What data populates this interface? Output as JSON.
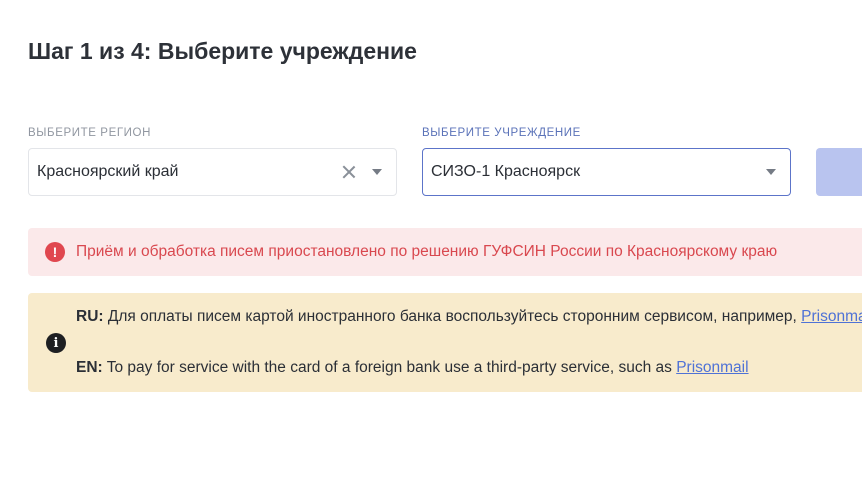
{
  "step": {
    "title": "Шаг 1 из 4: Выберите учреждение"
  },
  "region": {
    "label": "ВЫБЕРИТЕ РЕГИОН",
    "value": "Красноярский край",
    "clear_icon": "close-icon",
    "dropdown_icon": "chevron-down-icon"
  },
  "facility": {
    "label": "ВЫБЕРИТЕ УЧРЕЖДЕНИЕ",
    "value": "СИЗО-1 Красноярск",
    "dropdown_icon": "chevron-down-icon"
  },
  "submit": {
    "color": "#b9c4ef"
  },
  "alert_error": {
    "icon": "exclamation-circle-icon",
    "text": "Приём и обработка писем приостановлено по решению ГУФСИН России по Красноярскому краю",
    "color": "#d9484f",
    "background": "#fbe9ea"
  },
  "alert_info": {
    "icon": "info-circle-icon",
    "ru_prefix": "RU:",
    "ru_text": " Для оплаты писем картой иностранного банка воспользуйтесь сторонним сервисом, например, ",
    "ru_link": "Prisonmail",
    "en_prefix": "EN:",
    "en_text": " To pay for service with the card of a foreign bank use a third-party service, such as ",
    "en_link": "Prisonmail",
    "background": "#f8ebcc",
    "link_color": "#4f72d6"
  }
}
